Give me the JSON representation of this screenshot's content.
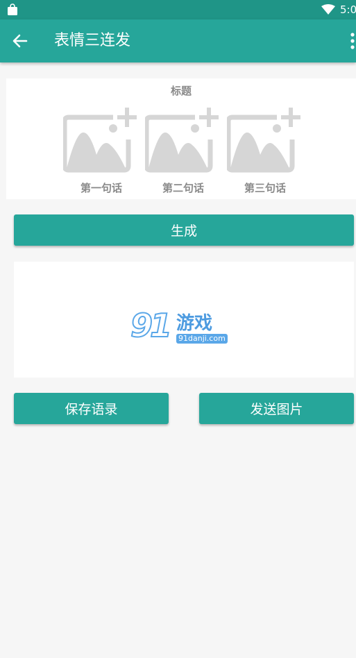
{
  "status_bar": {
    "time": "5:0"
  },
  "app_bar": {
    "title": "表情三连发"
  },
  "input_card": {
    "heading": "标题",
    "slots": [
      {
        "caption": "第一句话"
      },
      {
        "caption": "第二句话"
      },
      {
        "caption": "第三句话"
      }
    ]
  },
  "actions": {
    "generate_label": "生成",
    "save_label": "保存语录",
    "send_label": "发送图片"
  },
  "preview": {
    "watermark_brand": "91",
    "watermark_text": "游戏",
    "watermark_url": "91danji.com"
  },
  "colors": {
    "primary": "#26a69a",
    "primary_dark": "#1f9587",
    "placeholder_gray": "#d6d6d6",
    "caption_gray": "#8a8a8a"
  }
}
